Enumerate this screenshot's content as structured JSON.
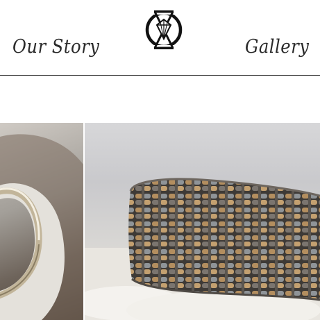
{
  "nav": {
    "left_label": "Our Story",
    "right_label": "Gallery"
  },
  "logo": {
    "icon": "diamond-emblem-icon"
  },
  "gallery": {
    "images": [
      {
        "icon": "silver-bangle-photo"
      },
      {
        "icon": "woven-metal-cuff-photo"
      }
    ]
  },
  "colors": {
    "text": "#2a2a2a",
    "divider": "#333333",
    "background": "#ffffff"
  }
}
